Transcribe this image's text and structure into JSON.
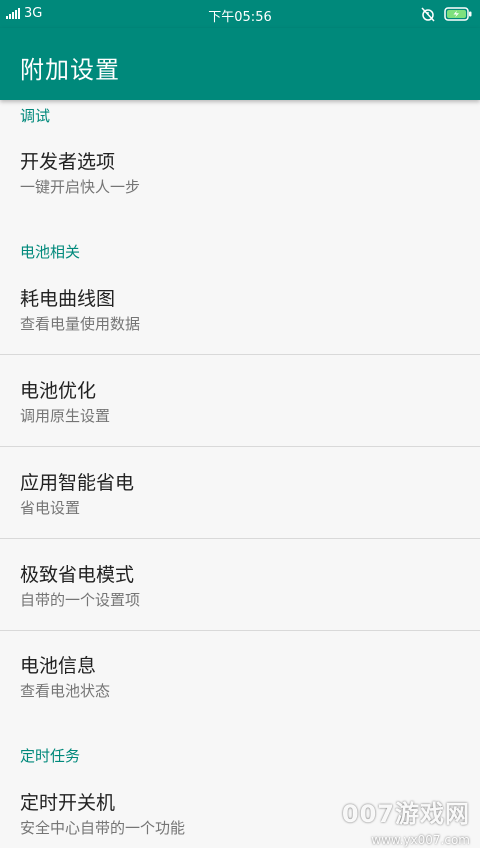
{
  "status_bar": {
    "network": "3G",
    "time": "下午05:56",
    "icons": [
      "signal-icon",
      "alarm-off-icon",
      "battery-charging-icon"
    ]
  },
  "app_bar": {
    "title": "附加设置"
  },
  "sections": [
    {
      "header": "调试",
      "items": [
        {
          "title": "开发者选项",
          "subtitle": "一键开启快人一步"
        }
      ]
    },
    {
      "header": "电池相关",
      "items": [
        {
          "title": "耗电曲线图",
          "subtitle": "查看电量使用数据"
        },
        {
          "title": "电池优化",
          "subtitle": "调用原生设置"
        },
        {
          "title": "应用智能省电",
          "subtitle": "省电设置"
        },
        {
          "title": "极致省电模式",
          "subtitle": "自带的一个设置项"
        },
        {
          "title": "电池信息",
          "subtitle": "查看电池状态"
        }
      ]
    },
    {
      "header": "定时任务",
      "items": [
        {
          "title": "定时开关机",
          "subtitle": "安全中心自带的一个功能"
        }
      ]
    }
  ],
  "watermark": {
    "brand": "007游戏网",
    "url": "www.yx007.com"
  },
  "colors": {
    "accent": "#00897b",
    "background": "#f7f7f7",
    "divider": "#d9d9d9"
  }
}
